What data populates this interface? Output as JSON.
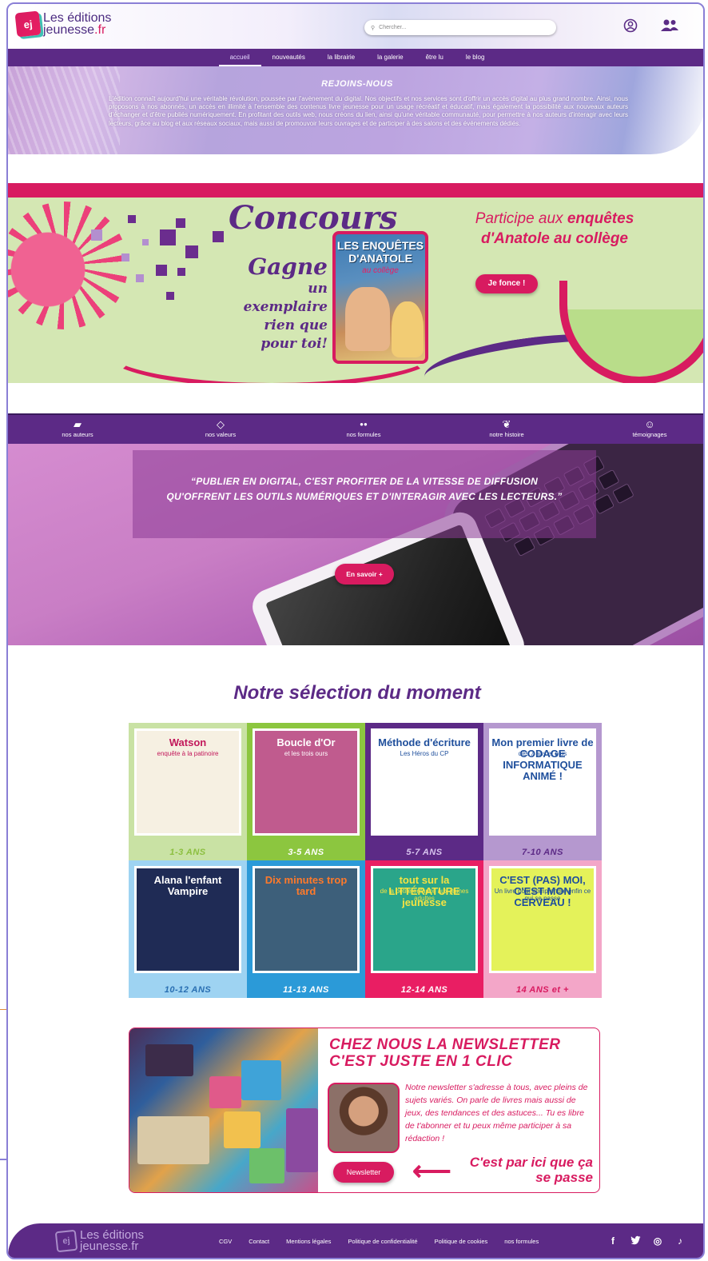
{
  "header": {
    "logo_line1": "Les éditions",
    "logo_line2": "jeunesse",
    "logo_suffix": ".fr",
    "logo_mark": "ej",
    "search_placeholder": "Chercher...",
    "icons": [
      "user-circle-icon",
      "users-icon"
    ]
  },
  "nav": {
    "items": [
      "accueil",
      "nouveautés",
      "la librairie",
      "la galerie",
      "être lu",
      "le blog"
    ],
    "active": "accueil"
  },
  "join": {
    "title": "REJOINS-NOUS",
    "text": "L'édition connaît aujourd'hui une véritable révolution, poussée par l'avènement du digital. Nos objectifs et nos services sont d'offrir un accès digital au plus grand nombre. Ainsi, nous proposons à nos abonnés, un accès en illimité à l'ensemble des contenus livre jeunesse pour un usage récréatif et éducatif, mais également la possibilité aux nouveaux auteurs d'échanger et d'être publiés numériquement. En profitant des outils web, nous créons du lien, ainsi qu'une véritable communauté, pour permettre à nos auteurs d'interagir avec leurs lecteurs, grâce au blog et aux réseaux sociaux, mais aussi de promouvoir leurs ouvrages et de participer à des salons et des événements dédiés."
  },
  "banner": {
    "title": "Concours",
    "gagne": "Gagne",
    "gagne_sub": [
      "un exemplaire",
      "rien que",
      "pour toi!"
    ],
    "book_title": "LES ENQUÊTES D'ANATOLE",
    "book_sub": "au collège",
    "right_line1_a": "Participe aux ",
    "right_line1_b": "enquêtes",
    "right_line2": "d'Anatole au collège",
    "button": "Je fonce !",
    "colors": {
      "pink": "#d81b60",
      "purple": "#5c2a86",
      "green": "#d4e7b3"
    }
  },
  "iconbar": [
    {
      "label": "nos auteurs",
      "icon": "book-open-icon",
      "glyph": "▰"
    },
    {
      "label": "nos valeurs",
      "icon": "diamond-icon",
      "glyph": "◇"
    },
    {
      "label": "nos formules",
      "icon": "users-icon",
      "glyph": "●●"
    },
    {
      "label": "notre histoire",
      "icon": "leaf-icon",
      "glyph": "❦"
    },
    {
      "label": "témoignages",
      "icon": "smile-icon",
      "glyph": "☺"
    }
  ],
  "hero": {
    "quote": "“PUBLIER EN DIGITAL, C'EST PROFITER DE LA VITESSE DE DIFFUSION QU'OFFRENT LES OUTILS NUMÉRIQUES ET D'INTERAGIR AVEC LES LECTEURS.”",
    "button": "En savoir +"
  },
  "selection": {
    "title": "Notre sélection du moment",
    "items": [
      {
        "age": "1-3 ANS",
        "bg": "#c9e2a4",
        "text_color": "#8cbf3f",
        "cover_title": "Watson",
        "cover_sub": "enquête à la patinoire",
        "cover_bg": "#f6f0e2",
        "title_color": "#c2185b"
      },
      {
        "age": "3-5 ANS",
        "bg": "#8cc63f",
        "text_color": "#ffffff",
        "cover_title": "Boucle d'Or",
        "cover_sub": "et les trois ours",
        "cover_bg": "#c05b8e",
        "title_color": "#ffffff"
      },
      {
        "age": "5-7 ANS",
        "bg": "#5c2a86",
        "text_color": "#d8c5ef",
        "cover_title": "Méthode d'écriture",
        "cover_sub": "Les Héros du CP",
        "cover_bg": "#ffffff",
        "title_color": "#1f4f9c"
      },
      {
        "age": "7-10 ANS",
        "bg": "#b598cf",
        "text_color": "#5c2a86",
        "cover_title": "Mon premier livre de CODAGE INFORMATIQUE ANIMÉ !",
        "cover_sub": "dès 7 ans et plus",
        "cover_bg": "#ffffff",
        "title_color": "#1f4f9c"
      },
      {
        "age": "10-12 ANS",
        "bg": "#9ed3f2",
        "text_color": "#2a6fb2",
        "cover_title": "Alana l'enfant Vampire",
        "cover_sub": "",
        "cover_bg": "#1f2b55",
        "title_color": "#ffffff"
      },
      {
        "age": "11-13 ANS",
        "bg": "#2b9ad8",
        "text_color": "#ffffff",
        "cover_title": "Dix minutes trop tard",
        "cover_sub": "",
        "cover_bg": "#3d5f7a",
        "title_color": "#ff7a2a"
      },
      {
        "age": "12-14 ANS",
        "bg": "#e91e63",
        "text_color": "#ffffff",
        "cover_title": "tout sur la LITTÉRATURE jeunesse",
        "cover_sub": "de la petite enfance aux jeunes adultes",
        "cover_bg": "#2aa58a",
        "title_color": "#f5e342"
      },
      {
        "age": "14 ANS et +",
        "bg": "#f3a6c8",
        "text_color": "#d81b60",
        "cover_title": "C'EST (PAS) MOI, C'EST MON CERVEAU !",
        "cover_sub": "Un livre pour comprendre enfin ce qui se passe",
        "cover_bg": "#e4f25a",
        "title_color": "#1f4f9c"
      }
    ]
  },
  "newsletter": {
    "title": "CHEZ NOUS LA NEWSLETTER C'EST JUSTE EN 1 CLIC",
    "text": "Notre newsletter s'adresse à tous, avec pleins de sujets variés. On parle de livres mais aussi de jeux, des tendances et des astuces... Tu es libre de t'abonner et tu peux même participer à sa rédaction !",
    "button": "Newsletter",
    "cta": "C'est par ici que ça se passe"
  },
  "footer": {
    "logo_line1": "Les éditions",
    "logo_line2": "jeunesse.fr",
    "links": [
      "CGV",
      "Contact",
      "Mentions légales",
      "Politique de confidentialité",
      "Politique de cookies",
      "nos formules"
    ],
    "social": [
      {
        "name": "facebook-icon",
        "glyph": "f"
      },
      {
        "name": "twitter-icon",
        "glyph": "🐦"
      },
      {
        "name": "instagram-icon",
        "glyph": "◎"
      },
      {
        "name": "tiktok-icon",
        "glyph": "♪"
      }
    ]
  }
}
